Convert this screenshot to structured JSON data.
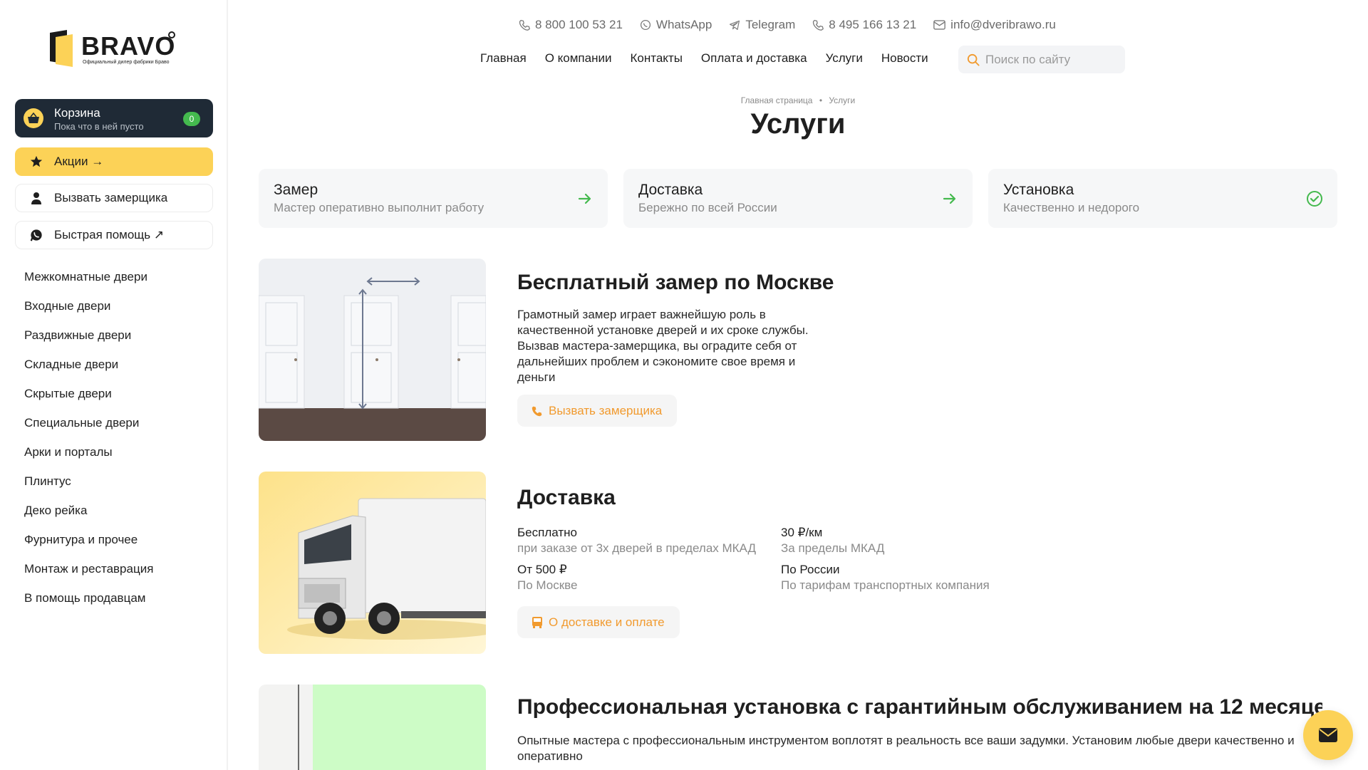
{
  "brand": {
    "name": "BRAVO",
    "tagline": "Официальный дилер фабрики Браво"
  },
  "cart": {
    "title": "Корзина",
    "subtitle": "Пока что в ней пусто",
    "count": "0"
  },
  "sidebar_buttons": {
    "promo": "Акции →",
    "measurer": "Вызвать замерщика",
    "help": "Быстрая помощь ↗"
  },
  "sidebar_menu": [
    "Межкомнатные двери",
    "Входные двери",
    "Раздвижные двери",
    "Складные двери",
    "Скрытые двери",
    "Специальные двери",
    "Арки и порталы",
    "Плинтус",
    "Деко рейка",
    "Фурнитура и прочее",
    "Монтаж и реставрация",
    "В помощь продавцам"
  ],
  "contacts": {
    "phone1": "8 800 100 53 21",
    "whatsapp": "WhatsApp",
    "telegram": "Telegram",
    "phone2": "8 495 166 13 21",
    "email": "info@dveribrawo.ru"
  },
  "nav": [
    "Главная",
    "О компании",
    "Контакты",
    "Оплата и доставка",
    "Услуги",
    "Новости"
  ],
  "search": {
    "placeholder": "Поиск по сайту"
  },
  "breadcrumb": {
    "home": "Главная страница",
    "sep": "•",
    "current": "Услуги"
  },
  "page_title": "Услуги",
  "services": [
    {
      "title": "Замер",
      "subtitle": "Мастер оперативно выполнит работу"
    },
    {
      "title": "Доставка",
      "subtitle": "Бережно по всей России"
    },
    {
      "title": "Установка",
      "subtitle": "Качественно и недорого"
    }
  ],
  "measure": {
    "title": "Бесплатный замер по Москве",
    "text": "Грамотный замер играет важнейшую роль в качественной установке дверей и их сроке службы. Вызвав мастера-замерщика, вы оградите себя от дальнейших проблем и сэкономите свое время и деньги",
    "button": "Вызвать замерщика"
  },
  "delivery": {
    "title": "Доставка",
    "items": [
      {
        "value": "Бесплатно",
        "note": "при заказе от 3х дверей в пределах МКАД"
      },
      {
        "value": "30 ₽/км",
        "note": "За пределы МКАД"
      },
      {
        "value": "От 500 ₽",
        "note": "По Москве"
      },
      {
        "value": "По России",
        "note": "По тарифам транспортных компания"
      }
    ],
    "button": "О доставке и оплате"
  },
  "install": {
    "title": "Профессиональная установка с гарантийным обслуживанием на 12 месяцев",
    "text": "Опытные мастера с профессиональным инструментом воплотят в реальность все ваши задумки. Установим любые двери качественно и оперативно"
  },
  "colors": {
    "accent": "#fcd257",
    "orange": "#f19a2e",
    "dark": "#1f2a36",
    "green": "#44b94e"
  }
}
